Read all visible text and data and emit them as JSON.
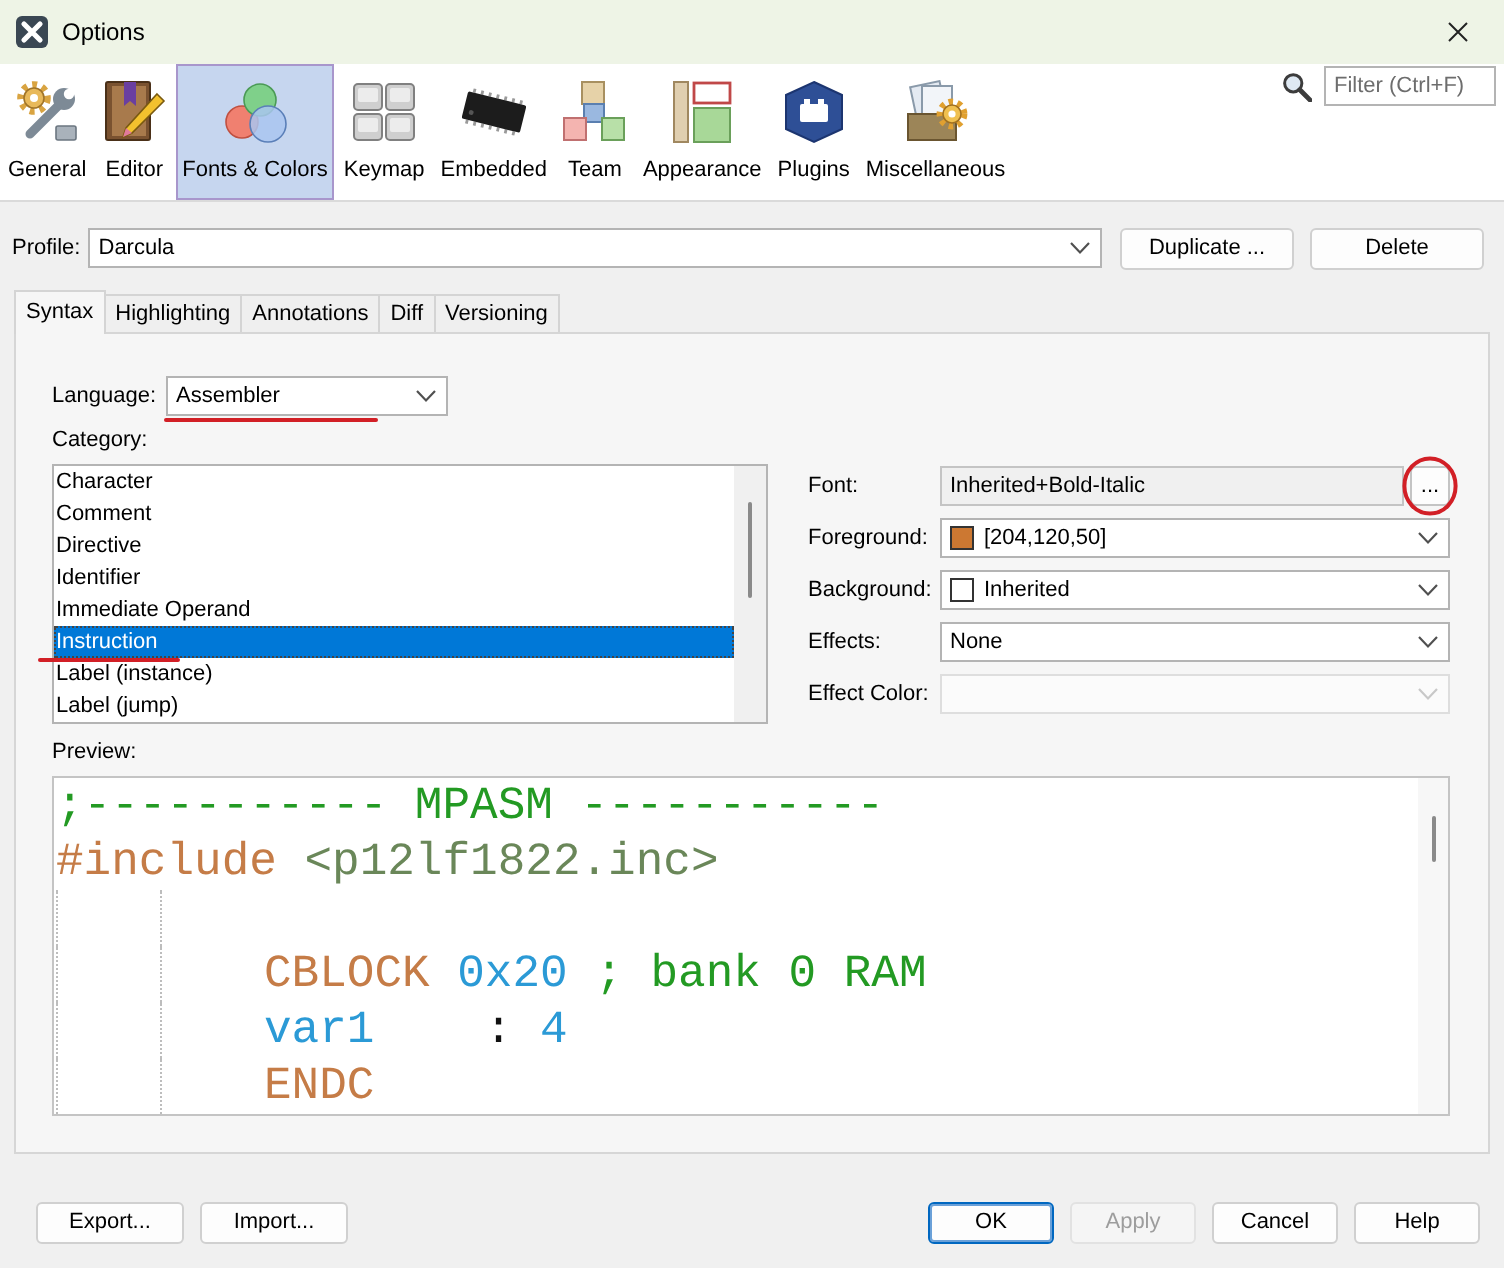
{
  "window": {
    "title": "Options"
  },
  "categories": [
    {
      "label": "General",
      "kind": "general",
      "selected": false
    },
    {
      "label": "Editor",
      "kind": "editor",
      "selected": false
    },
    {
      "label": "Fonts & Colors",
      "kind": "fonts",
      "selected": true
    },
    {
      "label": "Keymap",
      "kind": "keymap",
      "selected": false
    },
    {
      "label": "Embedded",
      "kind": "embedded",
      "selected": false
    },
    {
      "label": "Team",
      "kind": "team",
      "selected": false
    },
    {
      "label": "Appearance",
      "kind": "appearance",
      "selected": false
    },
    {
      "label": "Plugins",
      "kind": "plugins",
      "selected": false
    },
    {
      "label": "Miscellaneous",
      "kind": "misc",
      "selected": false
    }
  ],
  "filter": {
    "placeholder": "Filter (Ctrl+F)"
  },
  "profile": {
    "label": "Profile:",
    "value": "Darcula",
    "buttons": [
      "Duplicate ...",
      "Delete"
    ]
  },
  "tabs": [
    {
      "label": "Syntax",
      "selected": true
    },
    {
      "label": "Highlighting",
      "selected": false
    },
    {
      "label": "Annotations",
      "selected": false
    },
    {
      "label": "Diff",
      "selected": false
    },
    {
      "label": "Versioning",
      "selected": false
    }
  ],
  "language": {
    "label": "Language:",
    "value": "Assembler",
    "marked": true
  },
  "category": {
    "label": "Category:",
    "items": [
      {
        "label": "Character",
        "selected": false,
        "marked": false
      },
      {
        "label": "Comment",
        "selected": false,
        "marked": false
      },
      {
        "label": "Directive",
        "selected": false,
        "marked": false
      },
      {
        "label": "Identifier",
        "selected": false,
        "marked": false
      },
      {
        "label": "Immediate Operand",
        "selected": false,
        "marked": false
      },
      {
        "label": "Instruction",
        "selected": true,
        "marked": true
      },
      {
        "label": "Label (instance)",
        "selected": false,
        "marked": false
      },
      {
        "label": "Label (jump)",
        "selected": false,
        "marked": false
      }
    ]
  },
  "properties": [
    {
      "label": "Font:",
      "kind": "font",
      "value": "Inherited+Bold-Italic",
      "button": "...",
      "marked": true,
      "disabled": false
    },
    {
      "label": "Foreground:",
      "kind": "color",
      "value": "[204,120,50]",
      "color": "#cc7832",
      "marked": false,
      "disabled": false
    },
    {
      "label": "Background:",
      "kind": "color",
      "value": "Inherited",
      "color": "#ffffff",
      "marked": false,
      "disabled": false
    },
    {
      "label": "Effects:",
      "kind": "select",
      "value": "None",
      "marked": false,
      "disabled": false
    },
    {
      "label": "Effect Color:",
      "kind": "select",
      "marked": false,
      "disabled": true
    }
  ],
  "preview": {
    "label": "Preview:",
    "lines": [
      {
        "indented": false,
        "tokens": [
          {
            "text": ";----------- MPASM -----------",
            "kind": "comment"
          }
        ]
      },
      {
        "indented": false,
        "tokens": [
          {
            "text": "#include",
            "kind": "directive"
          },
          {
            "text": " <p12lf1822.inc>",
            "kind": "string"
          }
        ]
      },
      {
        "indented": true
      },
      {
        "indented": true,
        "tokens": [
          {
            "text": "CBLOCK",
            "kind": "keyword"
          },
          {
            "text": " 0x20",
            "kind": "number"
          },
          {
            "text": " ; bank 0 RAM",
            "kind": "comment"
          }
        ]
      },
      {
        "indented": true,
        "tokens": [
          {
            "text": "var1",
            "kind": "identifier"
          },
          {
            "text": "    :",
            "kind": "plain"
          },
          {
            "text": " 4",
            "kind": "number"
          }
        ]
      },
      {
        "indented": true,
        "tokens": [
          {
            "text": "ENDC",
            "kind": "keyword"
          }
        ]
      }
    ]
  },
  "buttons_left": [
    "Export...",
    "Import..."
  ],
  "buttons_right": [
    {
      "label": "OK",
      "default": true,
      "disabled": false
    },
    {
      "label": "Apply",
      "default": false,
      "disabled": true
    },
    {
      "label": "Cancel",
      "default": false,
      "disabled": false
    },
    {
      "label": "Help",
      "default": false,
      "disabled": false
    }
  ]
}
